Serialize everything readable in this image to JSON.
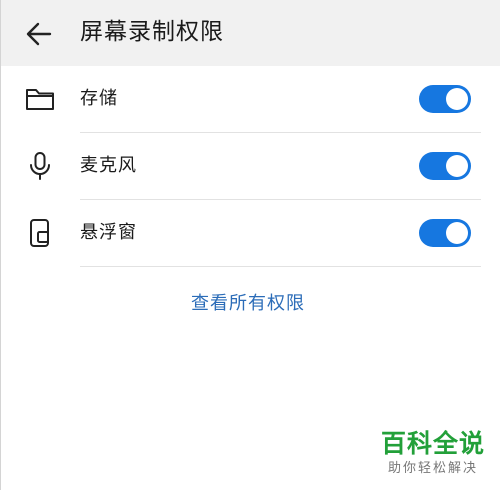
{
  "header": {
    "title": "屏幕录制权限",
    "back_icon": "arrow-left-icon"
  },
  "permissions": [
    {
      "label": "存储",
      "icon": "folder-icon",
      "enabled": true
    },
    {
      "label": "麦克风",
      "icon": "microphone-icon",
      "enabled": true
    },
    {
      "label": "悬浮窗",
      "icon": "floating-window-icon",
      "enabled": true
    }
  ],
  "view_all_link": "查看所有权限",
  "watermark": {
    "title": "百科全说",
    "subtitle": "助你轻松解决"
  },
  "colors": {
    "header_bg": "#f1f1f1",
    "toggle_on": "#1677e0",
    "link": "#2b6cb8",
    "watermark_green": "#22a039"
  }
}
